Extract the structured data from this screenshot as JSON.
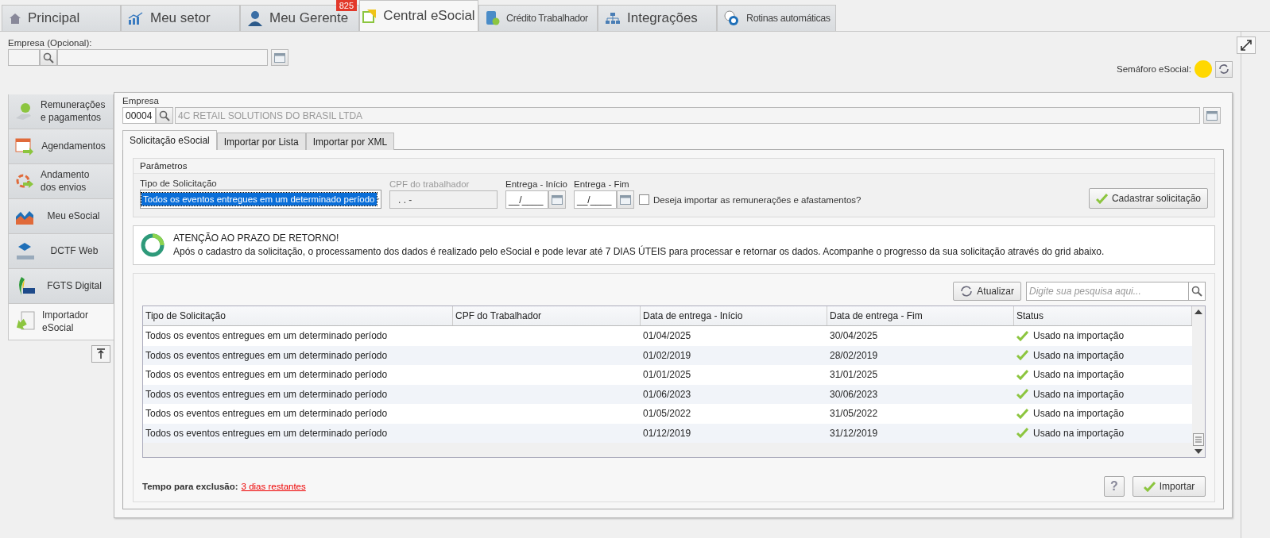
{
  "top_tabs": [
    {
      "label": "Principal",
      "selected": false
    },
    {
      "label": "Meu setor",
      "selected": false
    },
    {
      "label": "Meu Gerente",
      "selected": false,
      "badge": "825"
    },
    {
      "label": "Central eSocial",
      "selected": true
    },
    {
      "label": "Crédito Trabalhador",
      "selected": false
    },
    {
      "label": "Integrações",
      "selected": false
    },
    {
      "label": "Rotinas automáticas",
      "selected": false
    }
  ],
  "company_filter": {
    "label": "Empresa (Opcional):"
  },
  "semaphore": {
    "label": "Semáforo eSocial:"
  },
  "side_menu": [
    {
      "label": "Remunerações e pagamentos",
      "selected": false
    },
    {
      "label": "Agendamentos",
      "selected": false
    },
    {
      "label": "Andamento dos envios",
      "selected": false
    },
    {
      "label": "Meu eSocial",
      "selected": false
    },
    {
      "label": "DCTF Web",
      "selected": false
    },
    {
      "label": "FGTS Digital",
      "selected": false
    },
    {
      "label": "Importador eSocial",
      "selected": true
    }
  ],
  "company": {
    "label": "Empresa",
    "code": "00004",
    "name": "4C RETAIL SOLUTIONS DO BRASIL LTDA"
  },
  "sub_tabs": [
    {
      "label": "Solicitação eSocial",
      "selected": true
    },
    {
      "label": "Importar por Lista",
      "selected": false
    },
    {
      "label": "Importar por XML",
      "selected": false
    }
  ],
  "parameters": {
    "title": "Parâmetros",
    "request_type": {
      "label": "Tipo de Solicitação",
      "value": "Todos os eventos entregues em um determinado período"
    },
    "cpf": {
      "label": "CPF do trabalhador",
      "value": ".   .   -",
      "disabled": true
    },
    "start": {
      "label": "Entrega - Início",
      "value": "__/____"
    },
    "end": {
      "label": "Entrega - Fim",
      "value": "__/____"
    },
    "import_checkbox": {
      "label": "Deseja importar as remunerações e afastamentos?",
      "checked": false
    },
    "submit_button": "Cadastrar solicitação"
  },
  "notice": {
    "title": "ATENÇÃO AO PRAZO DE RETORNO!",
    "text": "Após o cadastro da solicitação, o processamento dos dados é realizado pelo eSocial e pode levar até 7 DIAS ÚTEIS para processar e retornar os dados. Acompanhe o progresso da sua solicitação através do grid abaixo."
  },
  "grid": {
    "refresh_button": "Atualizar",
    "search_placeholder": "Digite sua pesquisa aqui...",
    "columns": [
      "Tipo de Solicitação",
      "CPF do Trabalhador",
      "Data de entrega - Início",
      "Data de entrega - Fim",
      "Status"
    ],
    "rows": [
      {
        "type": "Todos os eventos entregues em um determinado período",
        "cpf": "",
        "start": "01/04/2025",
        "end": "30/04/2025",
        "status": "Usado na importação"
      },
      {
        "type": "Todos os eventos entregues em um determinado período",
        "cpf": "",
        "start": "01/02/2019",
        "end": "28/02/2019",
        "status": "Usado na importação"
      },
      {
        "type": "Todos os eventos entregues em um determinado período",
        "cpf": "",
        "start": "01/01/2025",
        "end": "31/01/2025",
        "status": "Usado na importação"
      },
      {
        "type": "Todos os eventos entregues em um determinado período",
        "cpf": "",
        "start": "01/06/2023",
        "end": "30/06/2023",
        "status": "Usado na importação"
      },
      {
        "type": "Todos os eventos entregues em um determinado período",
        "cpf": "",
        "start": "01/05/2022",
        "end": "31/05/2022",
        "status": "Usado na importação"
      },
      {
        "type": "Todos os eventos entregues em um determinado período",
        "cpf": "",
        "start": "01/12/2019",
        "end": "31/12/2019",
        "status": "Usado na importação"
      }
    ]
  },
  "footer": {
    "label": "Tempo para exclusão:",
    "link": "3 dias restantes",
    "help_button": "?",
    "import_button": "Importar"
  }
}
